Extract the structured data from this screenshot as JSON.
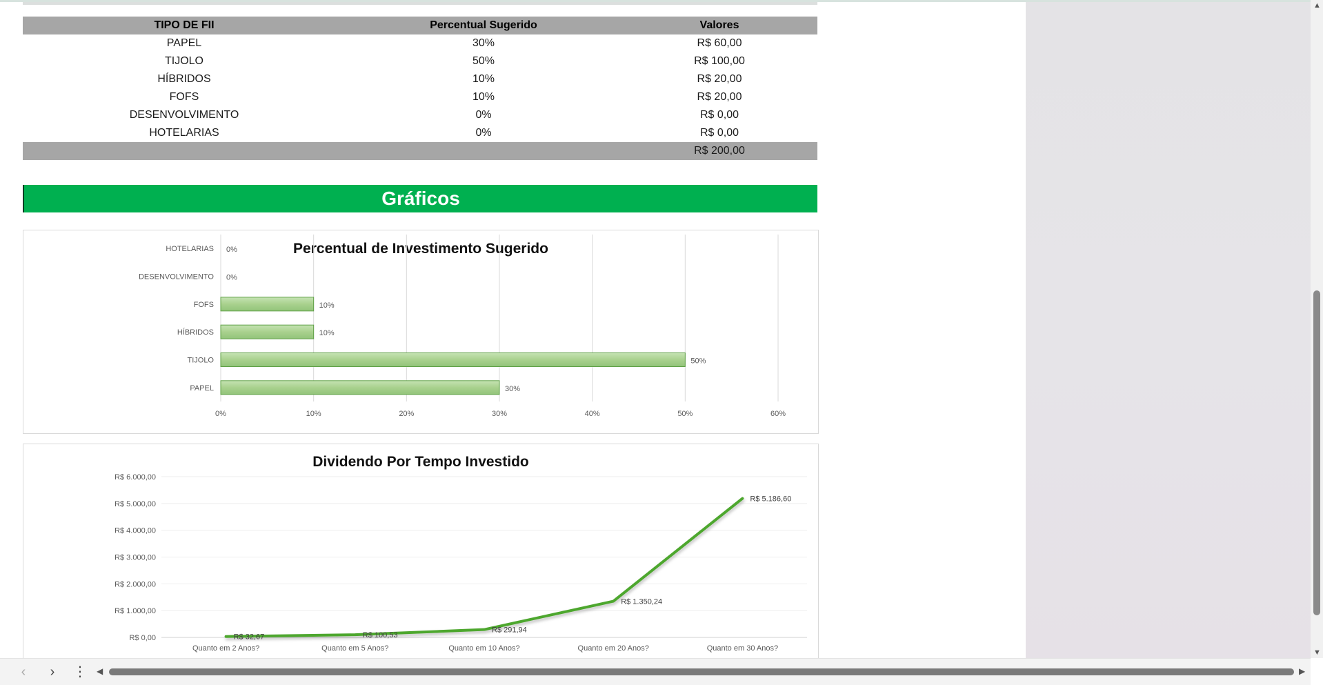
{
  "table": {
    "headers": [
      "TIPO DE FII",
      "Percentual Sugerido",
      "Valores"
    ],
    "rows": [
      [
        "PAPEL",
        "30%",
        "R$ 60,00"
      ],
      [
        "TIJOLO",
        "50%",
        "R$ 100,00"
      ],
      [
        "HÍBRIDOS",
        "10%",
        "R$ 20,00"
      ],
      [
        "FOFS",
        "10%",
        "R$ 20,00"
      ],
      [
        "DESENVOLVIMENTO",
        "0%",
        "R$ 0,00"
      ],
      [
        "HOTELARIAS",
        "0%",
        "R$ 0,00"
      ]
    ],
    "total": "R$ 200,00"
  },
  "banner": {
    "title": "Gráficos"
  },
  "colors": {
    "banner_green": "#00b050",
    "bar_fill": "#a9d18e",
    "line": "#4ea72e",
    "header_gray": "#a6a6a6"
  },
  "icons": {
    "back": "chevron-left-icon",
    "forward": "chevron-right-icon",
    "menu": "more-vertical-icon"
  },
  "chart_data": [
    {
      "type": "bar",
      "orientation": "horizontal",
      "title": "Percentual de Investimento Sugerido",
      "categories": [
        "PAPEL",
        "TIJOLO",
        "HÍBRIDOS",
        "FOFS",
        "DESENVOLVIMENTO",
        "HOTELARIAS"
      ],
      "values": [
        30,
        50,
        10,
        10,
        0,
        0
      ],
      "data_labels": [
        "30%",
        "50%",
        "10%",
        "10%",
        "0%",
        "0%"
      ],
      "xticks": [
        "0%",
        "10%",
        "20%",
        "30%",
        "40%",
        "50%",
        "60%"
      ],
      "xlim": [
        0,
        60
      ],
      "grid": true
    },
    {
      "type": "line",
      "title": "Dividendo Por Tempo Investido",
      "categories": [
        "Quanto em 2 Anos?",
        "Quanto em 5 Anos?",
        "Quanto em 10 Anos?",
        "Quanto em 20 Anos?",
        "Quanto em 30 Anos?"
      ],
      "values": [
        32.67,
        100.53,
        291.94,
        1350.24,
        5186.6
      ],
      "data_labels": [
        "R$ 32,67",
        "R$ 100,53",
        "R$ 291,94",
        "R$ 1.350,24",
        "R$ 5.186,60"
      ],
      "yticks": [
        "R$ 0,00",
        "R$ 1.000,00",
        "R$ 2.000,00",
        "R$ 3.000,00",
        "R$ 4.000,00",
        "R$ 5.000,00",
        "R$ 6.000,00"
      ],
      "ylim": [
        0,
        6000
      ],
      "grid": true
    }
  ]
}
